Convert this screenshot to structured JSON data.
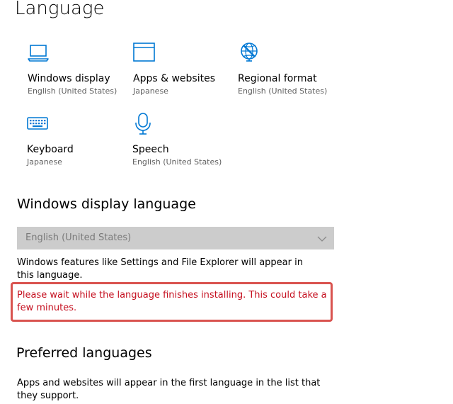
{
  "page": {
    "title": "Language"
  },
  "tiles": [
    {
      "label": "Windows display",
      "sub": "English (United States)",
      "icon": "laptop-icon"
    },
    {
      "label": "Apps & websites",
      "sub": "Japanese",
      "icon": "browser-window-icon"
    },
    {
      "label": "Regional format",
      "sub": "English (United States)",
      "icon": "globe-icon"
    },
    {
      "label": "Keyboard",
      "sub": "Japanese",
      "icon": "keyboard-icon"
    },
    {
      "label": "Speech",
      "sub": "English (United States)",
      "icon": "microphone-icon"
    }
  ],
  "display_language": {
    "heading": "Windows display language",
    "selected": "English (United States)",
    "description": "Windows features like Settings and File Explorer will appear in this language.",
    "warning": "Please wait while the language finishes installing. This could take a few minutes."
  },
  "preferred_languages": {
    "heading": "Preferred languages",
    "description": "Apps and websites will appear in the first language in the list that they support."
  },
  "colors": {
    "accent": "#0078d4",
    "warning_text": "#c50f1f",
    "highlight_border": "#d9534f",
    "disabled_fill": "#cccccc"
  }
}
